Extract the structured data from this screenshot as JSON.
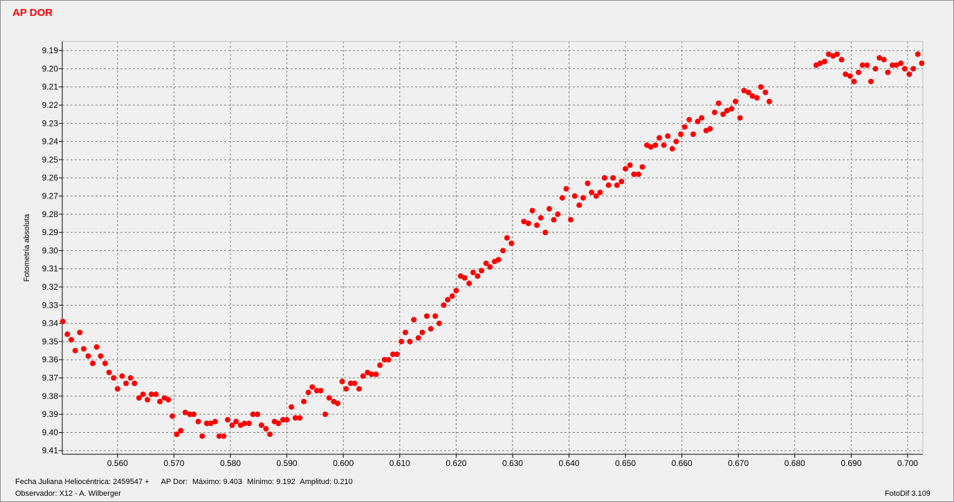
{
  "window": {
    "title": "AP DOR"
  },
  "footer": {
    "jd_label": "Fecha Juliana Heliocéntrica: 2459547 +",
    "star_label": "AP Dor:",
    "max_label": "Máximo: 9.403",
    "min_label": "Mínimo: 9.192",
    "amp_label": "Amplitud: 0.210",
    "observer": "Observador: X12 - A. Wilberger",
    "software": "FotoDif 3.109"
  },
  "colors": {
    "points": "#ff0000",
    "title": "#ff0000",
    "grid": "#808080",
    "background": "#f0f0f0"
  },
  "chart_data": {
    "type": "scatter",
    "title": "AP DOR",
    "xlabel": "",
    "ylabel": "Fotometría absoluta",
    "xlim": [
      0.5502,
      0.7027
    ],
    "ylim": [
      9.185,
      9.412
    ],
    "y_inverted": true,
    "grid": true,
    "xticks": [
      0.56,
      0.57,
      0.58,
      0.59,
      0.6,
      0.61,
      0.62,
      0.63,
      0.64,
      0.65,
      0.66,
      0.67,
      0.68,
      0.69,
      0.7
    ],
    "xtick_labels": [
      "0.560",
      "0.570",
      "0.580",
      "0.590",
      "0.600",
      "0.610",
      "0.620",
      "0.630",
      "0.640",
      "0.650",
      "0.660",
      "0.670",
      "0.680",
      "0.690",
      "0.700"
    ],
    "yticks": [
      9.19,
      9.2,
      9.21,
      9.22,
      9.23,
      9.24,
      9.25,
      9.26,
      9.27,
      9.28,
      9.29,
      9.3,
      9.31,
      9.32,
      9.33,
      9.34,
      9.35,
      9.36,
      9.37,
      9.38,
      9.39,
      9.4,
      9.41
    ],
    "ytick_labels": [
      "9.19",
      "9.20",
      "9.21",
      "9.22",
      "9.23",
      "9.24",
      "9.25",
      "9.26",
      "9.27",
      "9.28",
      "9.29",
      "9.30",
      "9.31",
      "9.32",
      "9.33",
      "9.34",
      "9.35",
      "9.36",
      "9.37",
      "9.38",
      "9.39",
      "9.40",
      "9.41"
    ],
    "points": [
      [
        0.5503,
        9.339
      ],
      [
        0.5511,
        9.346
      ],
      [
        0.5518,
        9.349
      ],
      [
        0.5525,
        9.355
      ],
      [
        0.5533,
        9.345
      ],
      [
        0.554,
        9.354
      ],
      [
        0.5548,
        9.358
      ],
      [
        0.5556,
        9.362
      ],
      [
        0.5563,
        9.353
      ],
      [
        0.557,
        9.358
      ],
      [
        0.5578,
        9.362
      ],
      [
        0.5585,
        9.367
      ],
      [
        0.5593,
        9.37
      ],
      [
        0.56,
        9.376
      ],
      [
        0.5608,
        9.369
      ],
      [
        0.5615,
        9.373
      ],
      [
        0.5623,
        9.37
      ],
      [
        0.563,
        9.373
      ],
      [
        0.5638,
        9.381
      ],
      [
        0.5645,
        9.379
      ],
      [
        0.5653,
        9.382
      ],
      [
        0.566,
        9.379
      ],
      [
        0.5668,
        9.379
      ],
      [
        0.5675,
        9.383
      ],
      [
        0.5683,
        9.381
      ],
      [
        0.569,
        9.382
      ],
      [
        0.5697,
        9.391
      ],
      [
        0.5705,
        9.401
      ],
      [
        0.5712,
        9.399
      ],
      [
        0.572,
        9.389
      ],
      [
        0.5728,
        9.39
      ],
      [
        0.5735,
        9.39
      ],
      [
        0.5743,
        9.394
      ],
      [
        0.575,
        9.402
      ],
      [
        0.5758,
        9.395
      ],
      [
        0.5765,
        9.395
      ],
      [
        0.5773,
        9.394
      ],
      [
        0.578,
        9.402
      ],
      [
        0.5788,
        9.402
      ],
      [
        0.5795,
        9.393
      ],
      [
        0.5803,
        9.396
      ],
      [
        0.581,
        9.394
      ],
      [
        0.5818,
        9.396
      ],
      [
        0.5825,
        9.395
      ],
      [
        0.5833,
        9.395
      ],
      [
        0.584,
        9.39
      ],
      [
        0.5848,
        9.39
      ],
      [
        0.5855,
        9.396
      ],
      [
        0.5863,
        9.398
      ],
      [
        0.587,
        9.401
      ],
      [
        0.5878,
        9.394
      ],
      [
        0.5885,
        9.395
      ],
      [
        0.5893,
        9.393
      ],
      [
        0.59,
        9.393
      ],
      [
        0.5908,
        9.386
      ],
      [
        0.5915,
        9.392
      ],
      [
        0.5923,
        9.392
      ],
      [
        0.593,
        9.383
      ],
      [
        0.5938,
        9.378
      ],
      [
        0.5945,
        9.375
      ],
      [
        0.5953,
        9.377
      ],
      [
        0.596,
        9.377
      ],
      [
        0.5968,
        9.39
      ],
      [
        0.5975,
        9.381
      ],
      [
        0.5983,
        9.383
      ],
      [
        0.599,
        9.384
      ],
      [
        0.5998,
        9.372
      ],
      [
        0.6005,
        9.376
      ],
      [
        0.6013,
        9.373
      ],
      [
        0.602,
        9.373
      ],
      [
        0.6028,
        9.376
      ],
      [
        0.6035,
        9.369
      ],
      [
        0.6043,
        9.367
      ],
      [
        0.605,
        9.368
      ],
      [
        0.6058,
        9.368
      ],
      [
        0.6065,
        9.363
      ],
      [
        0.6073,
        9.36
      ],
      [
        0.608,
        9.36
      ],
      [
        0.6088,
        9.357
      ],
      [
        0.6095,
        9.357
      ],
      [
        0.6103,
        9.35
      ],
      [
        0.611,
        9.345
      ],
      [
        0.6118,
        9.35
      ],
      [
        0.6125,
        9.338
      ],
      [
        0.6133,
        9.348
      ],
      [
        0.614,
        9.345
      ],
      [
        0.6148,
        9.336
      ],
      [
        0.6155,
        9.343
      ],
      [
        0.6163,
        9.336
      ],
      [
        0.617,
        9.34
      ],
      [
        0.6178,
        9.33
      ],
      [
        0.6185,
        9.327
      ],
      [
        0.6193,
        9.325
      ],
      [
        0.62,
        9.322
      ],
      [
        0.6208,
        9.314
      ],
      [
        0.6215,
        9.315
      ],
      [
        0.6223,
        9.318
      ],
      [
        0.623,
        9.312
      ],
      [
        0.6238,
        9.314
      ],
      [
        0.6245,
        9.311
      ],
      [
        0.6253,
        9.307
      ],
      [
        0.626,
        9.309
      ],
      [
        0.6268,
        9.306
      ],
      [
        0.6275,
        9.305
      ],
      [
        0.6283,
        9.3
      ],
      [
        0.629,
        9.293
      ],
      [
        0.6298,
        9.296
      ],
      [
        0.632,
        9.284
      ],
      [
        0.6328,
        9.285
      ],
      [
        0.6335,
        9.278
      ],
      [
        0.6343,
        9.286
      ],
      [
        0.635,
        9.282
      ],
      [
        0.6358,
        9.29
      ],
      [
        0.6365,
        9.277
      ],
      [
        0.6373,
        9.283
      ],
      [
        0.638,
        9.28
      ],
      [
        0.6388,
        9.271
      ],
      [
        0.6395,
        9.266
      ],
      [
        0.6403,
        9.283
      ],
      [
        0.641,
        9.27
      ],
      [
        0.6418,
        9.275
      ],
      [
        0.6425,
        9.271
      ],
      [
        0.6433,
        9.263
      ],
      [
        0.644,
        9.268
      ],
      [
        0.6448,
        9.27
      ],
      [
        0.6455,
        9.268
      ],
      [
        0.6463,
        9.26
      ],
      [
        0.647,
        9.264
      ],
      [
        0.6478,
        9.26
      ],
      [
        0.6485,
        9.264
      ],
      [
        0.6493,
        9.262
      ],
      [
        0.65,
        9.255
      ],
      [
        0.6508,
        9.253
      ],
      [
        0.6515,
        9.258
      ],
      [
        0.6523,
        9.258
      ],
      [
        0.653,
        9.254
      ],
      [
        0.6538,
        9.242
      ],
      [
        0.6545,
        9.243
      ],
      [
        0.6553,
        9.242
      ],
      [
        0.656,
        9.238
      ],
      [
        0.6568,
        9.242
      ],
      [
        0.6575,
        9.237
      ],
      [
        0.6583,
        9.244
      ],
      [
        0.659,
        9.24
      ],
      [
        0.6598,
        9.236
      ],
      [
        0.6605,
        9.232
      ],
      [
        0.6613,
        9.228
      ],
      [
        0.662,
        9.236
      ],
      [
        0.6628,
        9.229
      ],
      [
        0.6635,
        9.227
      ],
      [
        0.6643,
        9.234
      ],
      [
        0.665,
        9.233
      ],
      [
        0.6658,
        9.224
      ],
      [
        0.6665,
        9.219
      ],
      [
        0.6673,
        9.225
      ],
      [
        0.668,
        9.223
      ],
      [
        0.6688,
        9.222
      ],
      [
        0.6695,
        9.218
      ],
      [
        0.6703,
        9.227
      ],
      [
        0.671,
        9.212
      ],
      [
        0.6718,
        9.213
      ],
      [
        0.6725,
        9.215
      ],
      [
        0.6733,
        9.216
      ],
      [
        0.674,
        9.21
      ],
      [
        0.6748,
        9.213
      ],
      [
        0.6755,
        9.218
      ],
      [
        0.6838,
        9.198
      ],
      [
        0.6845,
        9.197
      ],
      [
        0.6853,
        9.196
      ],
      [
        0.686,
        9.192
      ],
      [
        0.6868,
        9.193
      ],
      [
        0.6875,
        9.192
      ],
      [
        0.6883,
        9.195
      ],
      [
        0.689,
        9.203
      ],
      [
        0.6898,
        9.204
      ],
      [
        0.6905,
        9.207
      ],
      [
        0.6913,
        9.202
      ],
      [
        0.692,
        9.198
      ],
      [
        0.6928,
        9.198
      ],
      [
        0.6935,
        9.207
      ],
      [
        0.6943,
        9.2
      ],
      [
        0.695,
        9.194
      ],
      [
        0.6958,
        9.195
      ],
      [
        0.6965,
        9.202
      ],
      [
        0.6973,
        9.198
      ],
      [
        0.698,
        9.198
      ],
      [
        0.6988,
        9.197
      ],
      [
        0.6995,
        9.2
      ],
      [
        0.7003,
        9.203
      ],
      [
        0.701,
        9.2
      ],
      [
        0.7018,
        9.192
      ],
      [
        0.7025,
        9.197
      ]
    ]
  }
}
